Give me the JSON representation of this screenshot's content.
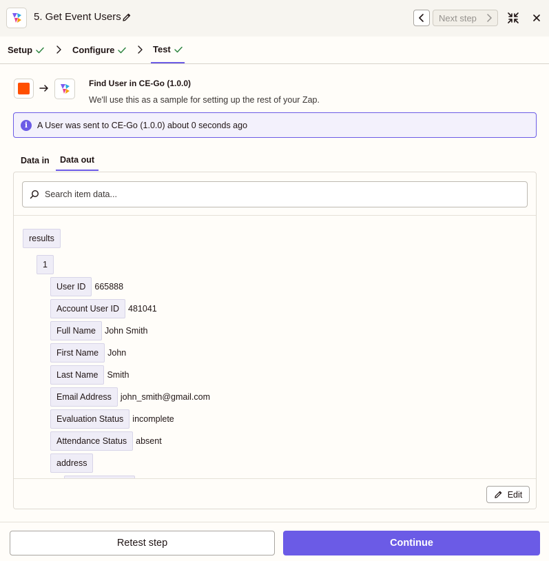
{
  "header": {
    "step_title": "5. Get Event Users",
    "next_step_label": "Next step"
  },
  "tabs": [
    {
      "label": "Setup",
      "completed": true
    },
    {
      "label": "Configure",
      "completed": true
    },
    {
      "label": "Test",
      "completed": true,
      "active": true
    }
  ],
  "summary": {
    "title": "Find User in CE-Go (1.0.0)",
    "subtitle": "We'll use this as a sample for setting up the rest of your Zap."
  },
  "info_bar": {
    "text": "A User was sent to CE-Go (1.0.0) about 0 seconds ago"
  },
  "data_tabs": [
    {
      "label": "Data in"
    },
    {
      "label": "Data out",
      "active": true
    }
  ],
  "search": {
    "placeholder": "Search item data..."
  },
  "tree": {
    "root_key": "results",
    "item_key": "1",
    "fields": [
      {
        "key": "User ID",
        "value": "665888"
      },
      {
        "key": "Account User ID",
        "value": "481041"
      },
      {
        "key": "Full Name",
        "value": "John Smith"
      },
      {
        "key": "First Name",
        "value": "John"
      },
      {
        "key": "Last Name",
        "value": "Smith"
      },
      {
        "key": "Email Address",
        "value": "john_smith@gmail.com"
      },
      {
        "key": "Evaluation Status",
        "value": "incomplete"
      },
      {
        "key": "Attendance Status",
        "value": "absent"
      },
      {
        "key": "address",
        "value": ""
      }
    ]
  },
  "edit_label": "Edit",
  "footer": {
    "retest_label": "Retest step",
    "continue_label": "Continue"
  },
  "colors": {
    "accent": "#6b5be6",
    "success": "#2e8540",
    "source_app": "#ff4f00"
  }
}
